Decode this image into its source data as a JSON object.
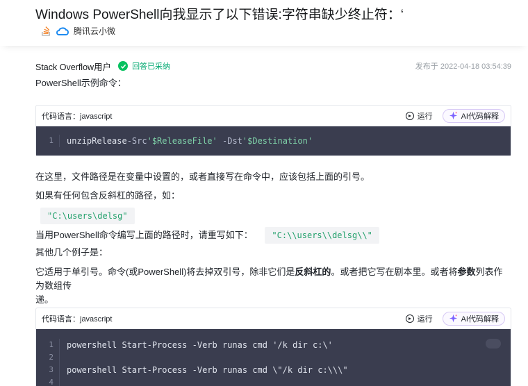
{
  "header": {
    "title": "Windows PowerShell向我显示了以下错误:字符串缺少终止符：‘",
    "source_name": "腾讯云小微"
  },
  "answer": {
    "author": "Stack Overflow用户",
    "accepted_label": "回答已采纳",
    "published": "发布于 2022-04-18 03:54:39"
  },
  "body": {
    "intro": "PowerShell示例命令：",
    "p1": "在这里，文件路径是在变量中设置的，或者直接写在命令中，应该包括上面的引号。",
    "p2": "如果有任何包含反斜杠的路径，如：",
    "inline1": "\"C:\\users\\delsg\"",
    "p3": "当用PowerShell命令编写上面的路径时，请重写如下：",
    "inline2": "\"C:\\\\users\\\\delsg\\\\\"",
    "p4": "其他几个例子是：",
    "p5_a": "它适用于单引号。命令(或PowerShell)将去掉双引号，除非它们是",
    "p5_b": "反斜杠的",
    "p5_c": "。或者把它写在剧本里。或者将",
    "p5_d": "参数",
    "p5_e": "列表作为数组传",
    "p5_f": "递。"
  },
  "code1": {
    "lang_label": "代码语言：javascript",
    "run_label": "运行",
    "ai_label": "AI代码解释",
    "lines": [
      {
        "n": "1",
        "a": "unzipRelease ",
        "b": "-Src ",
        "c": "'$ReleaseFile'",
        "d": " ",
        "e": "-Dst ",
        "f": "'$Destination'"
      }
    ]
  },
  "code2": {
    "lang_label": "代码语言：javascript",
    "run_label": "运行",
    "ai_label": "AI代码解释",
    "lines": [
      {
        "n": "1",
        "text": "powershell Start-Process -Verb runas cmd '/k dir c:\\'"
      },
      {
        "n": "2",
        "text": ""
      },
      {
        "n": "3",
        "text": "powershell Start-Process -Verb runas cmd \\\"/k dir c:\\\\\\\""
      },
      {
        "n": "4",
        "text": ""
      }
    ]
  },
  "colors": {
    "accent_green": "#07c160",
    "code_bg": "#3a3d4f",
    "string_green": "#7fd1a8"
  }
}
